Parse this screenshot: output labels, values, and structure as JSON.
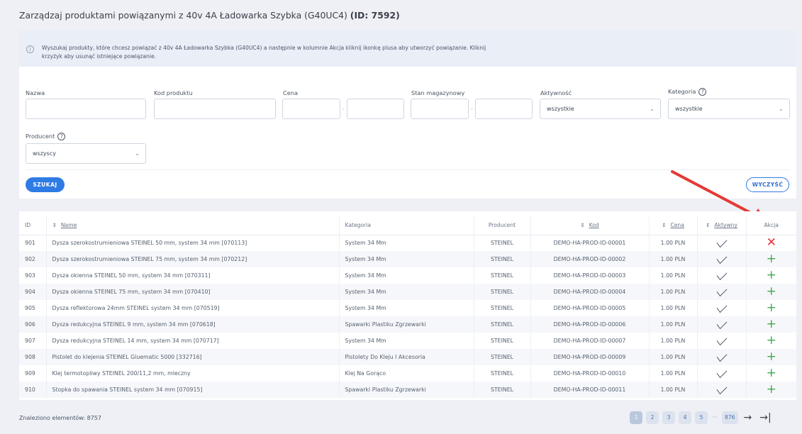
{
  "title": {
    "main": "Zarządzaj produktami powiązanymi z 40v 4A Ładowarka Szybka (G40UC4)",
    "id": "(ID: 7592)"
  },
  "info": {
    "text": "Wyszukaj produkty, które chcesz powiązać z 40v 4A Ładowarka Szybka (G40UC4) a następnie w kolumnie Akcja kliknij ikonkę plusa aby utworzyć powiązanie. Kliknij krzyżyk aby usunąć istniejące powiązanie."
  },
  "filters": {
    "name_label": "Nazwa",
    "code_label": "Kod produktu",
    "price_label": "Cena",
    "stock_label": "Stan magazynowy",
    "active_label": "Aktywność",
    "active_value": "wszystkie",
    "category_label": "Kategoria",
    "category_value": "wszystkie",
    "producer_label": "Producent",
    "producer_value": "wszyscy",
    "range_sep": "-",
    "help_mark": "?"
  },
  "buttons": {
    "search": "SZUKAJ",
    "clear": "WYCZYŚĆ"
  },
  "table": {
    "headers": {
      "id": "ID",
      "name": "Name",
      "category": "Kategoria",
      "producer": "Producent",
      "code": "Kod",
      "price": "Cena",
      "active": "Aktywny",
      "action": "Akcja"
    },
    "sort_mark": "⇕",
    "rows": [
      {
        "id": "901",
        "name": "Dysza szerokostrumieniowa STEINEL 50 mm, system 34 mm [070113]",
        "category": "System 34 Mm",
        "producer": "STEINEL",
        "code": "DEMO-HA-PROD-ID-00001",
        "price": "1.00 PLN",
        "action": "remove"
      },
      {
        "id": "902",
        "name": "Dysza szerokostrumieniowa STEINEL 75 mm, system 34 mm [070212]",
        "category": "System 34 Mm",
        "producer": "STEINEL",
        "code": "DEMO-HA-PROD-ID-00002",
        "price": "1.00 PLN",
        "action": "add"
      },
      {
        "id": "903",
        "name": "Dysza okienna STEINEL 50 mm, system 34 mm [070311]",
        "category": "System 34 Mm",
        "producer": "STEINEL",
        "code": "DEMO-HA-PROD-ID-00003",
        "price": "1.00 PLN",
        "action": "add"
      },
      {
        "id": "904",
        "name": "Dysza okienna STEINEL 75 mm, system 34 mm [070410]",
        "category": "System 34 Mm",
        "producer": "STEINEL",
        "code": "DEMO-HA-PROD-ID-00004",
        "price": "1.00 PLN",
        "action": "add"
      },
      {
        "id": "905",
        "name": "Dysza reflektorowa 24mm STEINEL system 34 mm [070519]",
        "category": "System 34 Mm",
        "producer": "STEINEL",
        "code": "DEMO-HA-PROD-ID-00005",
        "price": "1.00 PLN",
        "action": "add"
      },
      {
        "id": "906",
        "name": "Dysza redukcyjna STEINEL 9 mm, system 34 mm [070618]",
        "category": "Spawarki Plastiku Zgrzewarki",
        "producer": "STEINEL",
        "code": "DEMO-HA-PROD-ID-00006",
        "price": "1.00 PLN",
        "action": "add"
      },
      {
        "id": "907",
        "name": "Dysza redukcyjna STEINEL 14 mm, system 34 mm [070717]",
        "category": "System 34 Mm",
        "producer": "STEINEL",
        "code": "DEMO-HA-PROD-ID-00007",
        "price": "1.00 PLN",
        "action": "add"
      },
      {
        "id": "908",
        "name": "Pistolet do klejenia STEINEL Gluematic 5000 [332716]",
        "category": "Pistolety Do Kleju I Akcesoria",
        "producer": "STEINEL",
        "code": "DEMO-HA-PROD-ID-00009",
        "price": "1.00 PLN",
        "action": "add"
      },
      {
        "id": "909",
        "name": "Klej termotopliwy STEINEL 200/11,2 mm, mleczny",
        "category": "Klej Na Gorąco",
        "producer": "STEINEL",
        "code": "DEMO-HA-PROD-ID-00010",
        "price": "1.00 PLN",
        "action": "add"
      },
      {
        "id": "910",
        "name": "Stopka do spawania STEINEL system 34 mm [070915]",
        "category": "Spawarki Plastiku Zgrzewarki",
        "producer": "STEINEL",
        "code": "DEMO-HA-PROD-ID-00011",
        "price": "1.00 PLN",
        "action": "add"
      }
    ]
  },
  "footer": {
    "found": "Znaleziono elementów: 8757",
    "pages": [
      "1",
      "2",
      "3",
      "4",
      "5"
    ],
    "dots": "···",
    "last_page": "876",
    "next": "→",
    "last": "→|"
  },
  "colors": {
    "primary": "#2f7be5",
    "remove": "#e5323e",
    "add": "#3fa84b",
    "annotation_arrow": "#e53935"
  }
}
